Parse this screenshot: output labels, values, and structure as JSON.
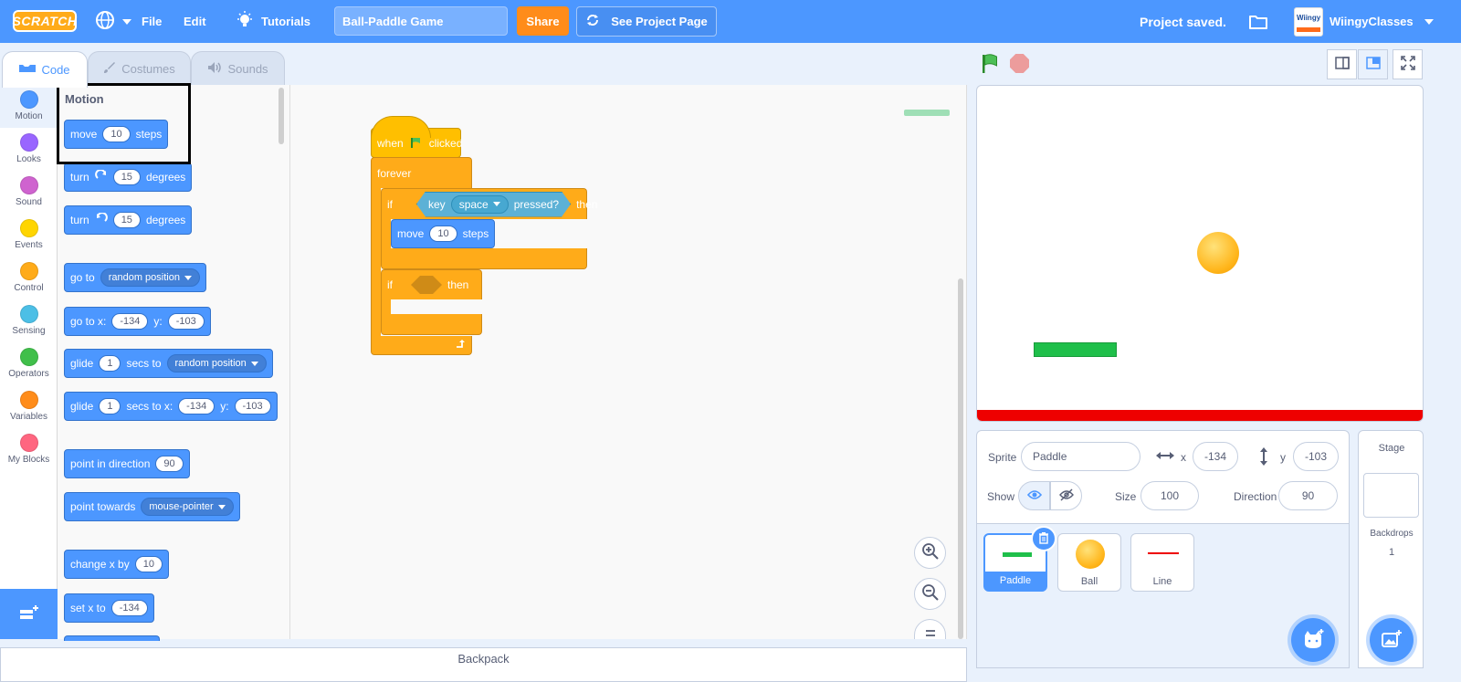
{
  "menubar": {
    "logo": "SCRATCH",
    "file": "File",
    "edit": "Edit",
    "tutorials": "Tutorials",
    "project_title": "Ball-Paddle Game",
    "share": "Share",
    "see_project": "See Project Page",
    "status": "Project saved.",
    "username": "WiingyClasses",
    "avatar_text": "Wiingy"
  },
  "tabs": [
    {
      "label": "Code"
    },
    {
      "label": "Costumes"
    },
    {
      "label": "Sounds"
    }
  ],
  "categories": [
    {
      "label": "Motion",
      "color": "#4c97ff"
    },
    {
      "label": "Looks",
      "color": "#9966ff"
    },
    {
      "label": "Sound",
      "color": "#cf63cf"
    },
    {
      "label": "Events",
      "color": "#ffd500"
    },
    {
      "label": "Control",
      "color": "#ffab19"
    },
    {
      "label": "Sensing",
      "color": "#4cbfe6"
    },
    {
      "label": "Operators",
      "color": "#40bf4a"
    },
    {
      "label": "Variables",
      "color": "#ff8c1a"
    },
    {
      "label": "My Blocks",
      "color": "#ff6680"
    }
  ],
  "palette": {
    "heading": "Motion",
    "move": {
      "a": "move",
      "n": "10",
      "b": "steps"
    },
    "turn_right": {
      "a": "turn",
      "n": "15",
      "b": "degrees"
    },
    "turn_left": {
      "a": "turn",
      "n": "15",
      "b": "degrees"
    },
    "goto": {
      "a": "go to",
      "opt": "random position"
    },
    "goto_xy": {
      "a": "go to x:",
      "x": "-134",
      "b": "y:",
      "y": "-103"
    },
    "glide": {
      "a": "glide",
      "n": "1",
      "b": "secs to",
      "opt": "random position"
    },
    "glide_xy": {
      "a": "glide",
      "n": "1",
      "b": "secs to x:",
      "x": "-134",
      "c": "y:",
      "y": "-103"
    },
    "point_dir": {
      "a": "point in direction",
      "n": "90"
    },
    "point_towards": {
      "a": "point towards",
      "opt": "mouse-pointer"
    },
    "change_x": {
      "a": "change x by",
      "n": "10"
    },
    "set_x": {
      "a": "set x to",
      "n": "-134"
    }
  },
  "script": {
    "when_a": "when",
    "when_b": "clicked",
    "forever": "forever",
    "if1": "if",
    "key_a": "key",
    "key_opt": "space",
    "key_b": "pressed?",
    "then1": "then",
    "move_a": "move",
    "move_n": "10",
    "move_b": "steps",
    "if2": "if",
    "then2": "then"
  },
  "sprite_info": {
    "sprite_label": "Sprite",
    "sprite_name": "Paddle",
    "x_label": "x",
    "x": "-134",
    "y_label": "y",
    "y": "-103",
    "show_label": "Show",
    "size_label": "Size",
    "size": "100",
    "direction_label": "Direction",
    "direction": "90"
  },
  "sprites": [
    {
      "name": "Paddle"
    },
    {
      "name": "Ball"
    },
    {
      "name": "Line"
    }
  ],
  "stage_panel": {
    "title": "Stage",
    "backdrops_label": "Backdrops",
    "backdrops_count": "1"
  },
  "backpack": "Backpack",
  "colors": {
    "accent": "#4c97ff",
    "motion": "#4c97ff",
    "control": "#ffab19",
    "events": "#ffbf00",
    "sensing": "#5cb1d6",
    "share": "#ff8c1a",
    "paddle": "#1fbf4a",
    "line": "#ee0000",
    "ball": "#ffb51a"
  }
}
